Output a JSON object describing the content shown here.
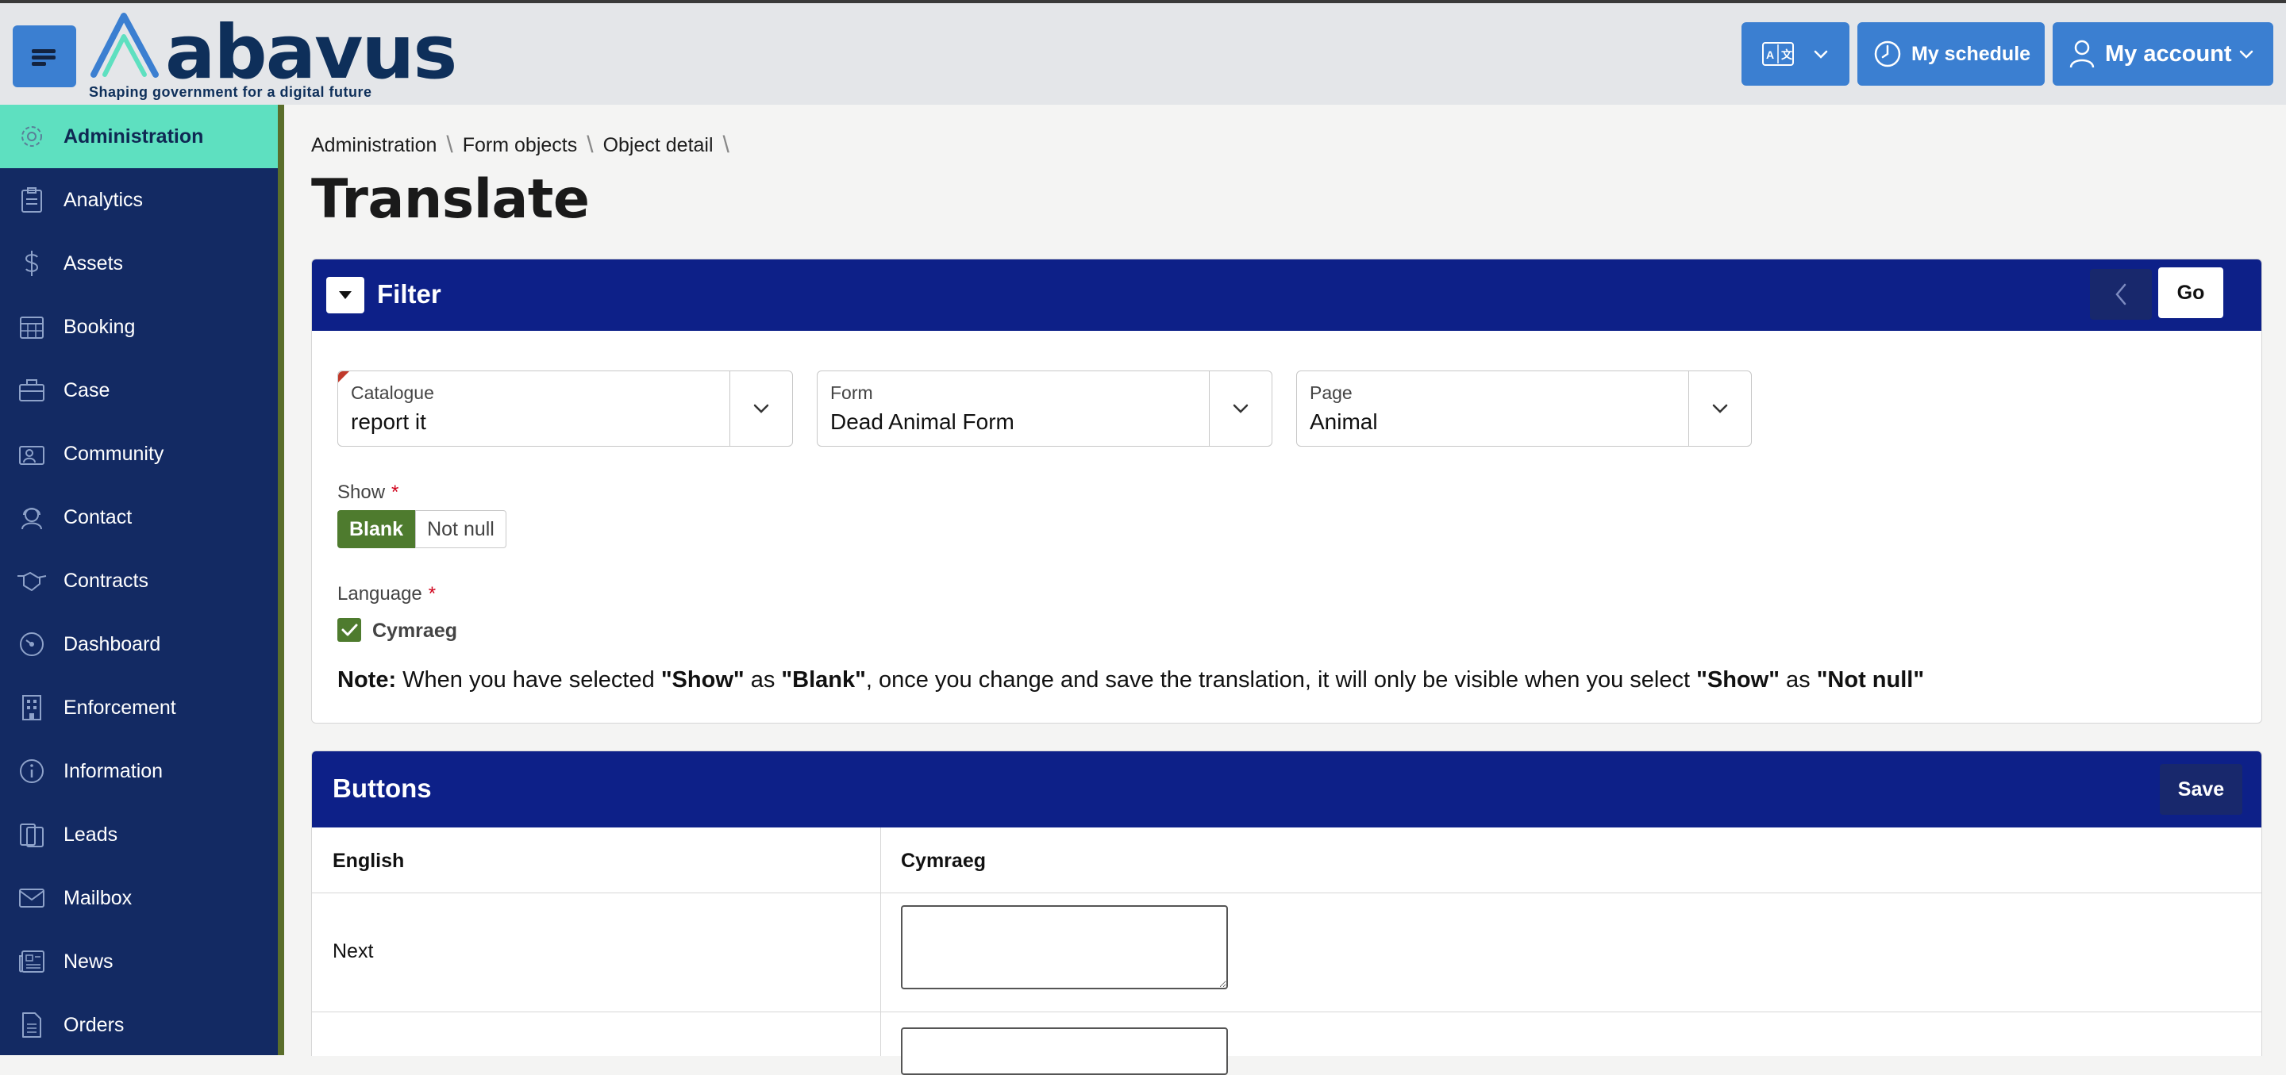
{
  "header": {
    "logo_text": "abavus",
    "logo_tagline": "Shaping government for a digital future",
    "schedule_label": "My schedule",
    "account_label": "My account",
    "icons": [
      "menu-icon",
      "translate-icon",
      "chevron-down-icon",
      "clock-icon",
      "user-icon"
    ]
  },
  "sidebar": {
    "items": [
      {
        "label": "Administration",
        "icon": "gear-icon",
        "active": true
      },
      {
        "label": "Analytics",
        "icon": "clipboard-icon"
      },
      {
        "label": "Assets",
        "icon": "dollar-icon"
      },
      {
        "label": "Booking",
        "icon": "calendar-icon"
      },
      {
        "label": "Case",
        "icon": "briefcase-icon"
      },
      {
        "label": "Community",
        "icon": "people-icon"
      },
      {
        "label": "Contact",
        "icon": "headset-icon"
      },
      {
        "label": "Contracts",
        "icon": "handshake-icon"
      },
      {
        "label": "Dashboard",
        "icon": "gauge-icon"
      },
      {
        "label": "Enforcement",
        "icon": "building-icon"
      },
      {
        "label": "Information",
        "icon": "info-icon"
      },
      {
        "label": "Leads",
        "icon": "clipboard-list-icon"
      },
      {
        "label": "Mailbox",
        "icon": "envelope-icon"
      },
      {
        "label": "News",
        "icon": "newspaper-icon"
      },
      {
        "label": "Orders",
        "icon": "document-icon"
      }
    ]
  },
  "breadcrumb": [
    "Administration",
    "Form objects",
    "Object detail"
  ],
  "page_title": "Translate",
  "filter": {
    "title": "Filter",
    "go_label": "Go",
    "catalogue": {
      "label": "Catalogue",
      "value": "report it"
    },
    "form": {
      "label": "Form",
      "value": "Dead Animal Form"
    },
    "page": {
      "label": "Page",
      "value": "Animal"
    },
    "show": {
      "label": "Show",
      "required": "*",
      "options": [
        "Blank",
        "Not null"
      ],
      "selected": "Blank"
    },
    "language": {
      "label": "Language",
      "required": "*",
      "option": "Cymraeg",
      "checked": true
    },
    "note": {
      "prefix": "Note:",
      "t1": " When you have selected ",
      "b1": "\"Show\"",
      "t2": " as ",
      "b2": "\"Blank\"",
      "t3": ", once you change and save the translation, it will only be visible when you select ",
      "b3": "\"Show\"",
      "t4": " as ",
      "b4": "\"Not null\""
    }
  },
  "buttons_section": {
    "title": "Buttons",
    "save_label": "Save",
    "columns": [
      "English",
      "Cymraeg"
    ],
    "rows": [
      {
        "english": "Next",
        "cymraeg": ""
      }
    ]
  },
  "colors": {
    "brand_blue": "#3b7fd1",
    "panel_header": "#0d2088",
    "sidebar": "#132a63",
    "active_nav": "#5ee0c0",
    "toggle_green": "#4e7b2e"
  }
}
